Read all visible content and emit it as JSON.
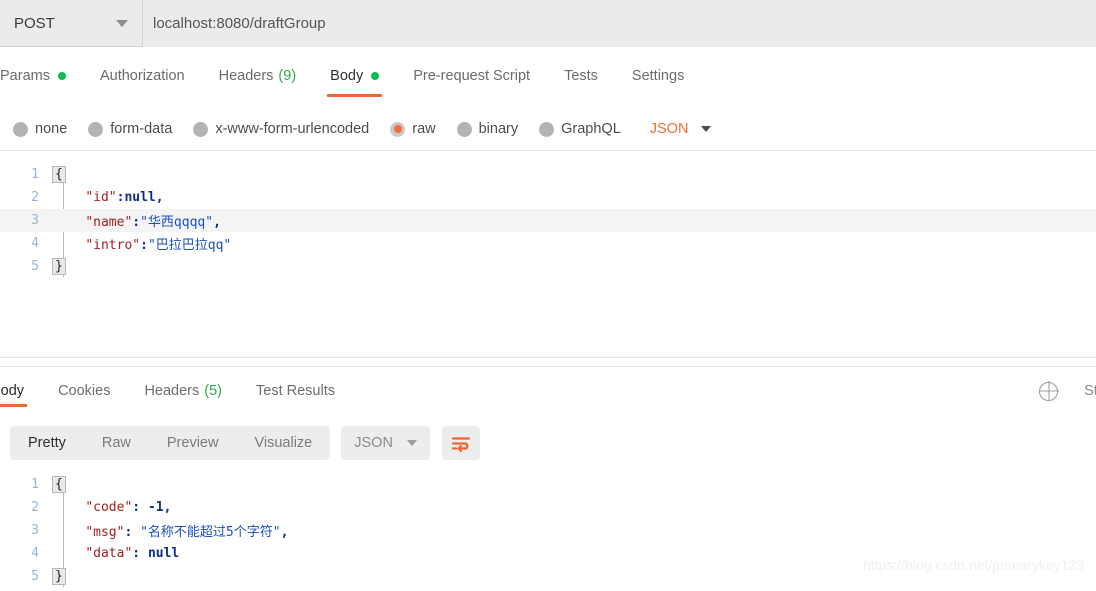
{
  "request_bar": {
    "method": "POST",
    "method_caret_icon": "chevron-down-icon",
    "url": "localhost:8080/draftGroup"
  },
  "request_tabs": [
    {
      "label": "Params",
      "badge_dot": true,
      "count": "",
      "active": false
    },
    {
      "label": "Authorization",
      "badge_dot": false,
      "count": "",
      "active": false
    },
    {
      "label": "Headers",
      "badge_dot": false,
      "count": "(9)",
      "active": false
    },
    {
      "label": "Body",
      "badge_dot": true,
      "count": "",
      "active": true
    },
    {
      "label": "Pre-request Script",
      "badge_dot": false,
      "count": "",
      "active": false
    },
    {
      "label": "Tests",
      "badge_dot": false,
      "count": "",
      "active": false
    },
    {
      "label": "Settings",
      "badge_dot": false,
      "count": "",
      "active": false
    }
  ],
  "body_types": {
    "options": [
      {
        "label": "none",
        "selected": false
      },
      {
        "label": "form-data",
        "selected": false
      },
      {
        "label": "x-www-form-urlencoded",
        "selected": false
      },
      {
        "label": "raw",
        "selected": true
      },
      {
        "label": "binary",
        "selected": false
      },
      {
        "label": "GraphQL",
        "selected": false
      }
    ],
    "format": "JSON",
    "format_caret_icon": "chevron-down-icon"
  },
  "request_body": {
    "language": "json",
    "lines": [
      {
        "num": "1",
        "highlight": false,
        "tokens": [
          {
            "t": "{",
            "c": "brace"
          }
        ]
      },
      {
        "num": "2",
        "highlight": false,
        "tokens": [
          {
            "t": "    ",
            "c": "plain"
          },
          {
            "t": "\"id\"",
            "c": "key"
          },
          {
            "t": ":",
            "c": "punct"
          },
          {
            "t": "null",
            "c": "null"
          },
          {
            "t": ",",
            "c": "punct"
          }
        ]
      },
      {
        "num": "3",
        "highlight": true,
        "tokens": [
          {
            "t": "    ",
            "c": "plain"
          },
          {
            "t": "\"name\"",
            "c": "key"
          },
          {
            "t": ":",
            "c": "punct"
          },
          {
            "t": "\"华西qqqq\"",
            "c": "str"
          },
          {
            "t": ",",
            "c": "punct"
          }
        ]
      },
      {
        "num": "4",
        "highlight": false,
        "tokens": [
          {
            "t": "    ",
            "c": "plain"
          },
          {
            "t": "\"intro\"",
            "c": "key"
          },
          {
            "t": ":",
            "c": "punct"
          },
          {
            "t": "\"巴拉巴拉qq\"",
            "c": "str"
          }
        ]
      },
      {
        "num": "5",
        "highlight": false,
        "tokens": [
          {
            "t": "}",
            "c": "brace"
          }
        ]
      }
    ]
  },
  "response_tabs": [
    {
      "label": "Body",
      "count": "",
      "active": true
    },
    {
      "label": "Cookies",
      "count": "",
      "active": false
    },
    {
      "label": "Headers",
      "count": "(5)",
      "active": false
    },
    {
      "label": "Test Results",
      "count": "",
      "active": false
    }
  ],
  "response_meta": {
    "globe_icon": "globe-icon",
    "status_label": "Statu"
  },
  "view_modes": {
    "segments": [
      {
        "label": "Pretty",
        "active": true
      },
      {
        "label": "Raw",
        "active": false
      },
      {
        "label": "Preview",
        "active": false
      },
      {
        "label": "Visualize",
        "active": false
      }
    ],
    "format": "JSON",
    "format_caret_icon": "chevron-down-icon",
    "wrap_icon": "wrap-text-icon"
  },
  "response_body": {
    "language": "json",
    "lines": [
      {
        "num": "1",
        "highlight": false,
        "tokens": [
          {
            "t": "{",
            "c": "brace"
          }
        ]
      },
      {
        "num": "2",
        "highlight": false,
        "tokens": [
          {
            "t": "    ",
            "c": "plain"
          },
          {
            "t": "\"code\"",
            "c": "key"
          },
          {
            "t": ": ",
            "c": "punct"
          },
          {
            "t": "-1",
            "c": "num"
          },
          {
            "t": ",",
            "c": "punct"
          }
        ]
      },
      {
        "num": "3",
        "highlight": false,
        "tokens": [
          {
            "t": "    ",
            "c": "plain"
          },
          {
            "t": "\"msg\"",
            "c": "key"
          },
          {
            "t": ": ",
            "c": "punct"
          },
          {
            "t": "\"名称不能超过5个字符\"",
            "c": "str"
          },
          {
            "t": ",",
            "c": "punct"
          }
        ]
      },
      {
        "num": "4",
        "highlight": false,
        "tokens": [
          {
            "t": "    ",
            "c": "plain"
          },
          {
            "t": "\"data\"",
            "c": "key"
          },
          {
            "t": ": ",
            "c": "punct"
          },
          {
            "t": "null",
            "c": "null"
          }
        ]
      },
      {
        "num": "5",
        "highlight": false,
        "tokens": [
          {
            "t": "}",
            "c": "brace"
          }
        ]
      }
    ]
  },
  "watermark": {
    "text": "https://blog.csdn.net/primarykey123"
  },
  "colors": {
    "accent_orange": "#ef6532",
    "dot_green": "#0cbb52",
    "count_green": "#2bab4f",
    "bar_gray": "#ebebeb",
    "json_key_red": "#a02020",
    "json_string_blue": "#1a4fbf",
    "json_literal_navy": "#0b2e8a",
    "line_number_blue": "#94b5d6"
  }
}
